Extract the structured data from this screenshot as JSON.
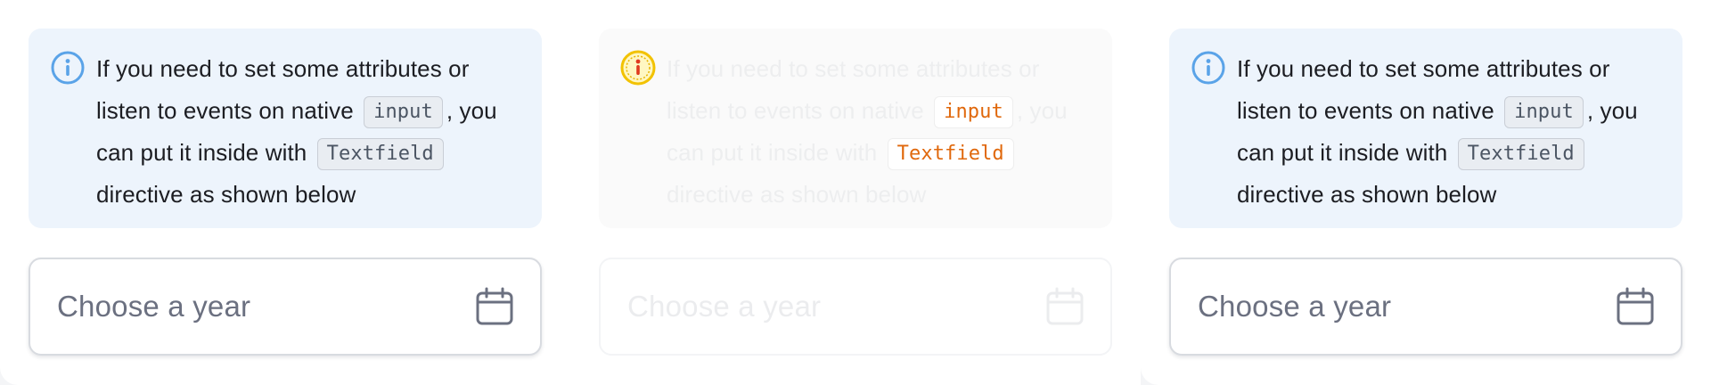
{
  "panels": [
    {
      "alert": {
        "text_1": "If you need to set some attributes or listen to events on native",
        "code_1": "input",
        "text_2": ", you can put it inside with",
        "code_2": "Textfield",
        "text_3": "directive as shown below"
      },
      "field": {
        "placeholder": "Choose a year"
      },
      "icons": {
        "alert": "info-icon",
        "field": "calendar-icon"
      }
    },
    {
      "alert": {
        "text_1": "If you need to set some attributes or listen to events on native",
        "code_1": "input",
        "text_2": ", you can put it inside with",
        "code_2": "Textfield",
        "text_3": "directive as shown below"
      },
      "field": {
        "placeholder": "Choose a year"
      },
      "icons": {
        "alert": "info-icon-highlighted",
        "field": "calendar-icon"
      }
    },
    {
      "alert": {
        "text_1": "If you need to set some attributes or listen to events on native",
        "code_1": "input",
        "text_2": ", you can put it inside with",
        "code_2": "Textfield",
        "text_3": "directive as shown below"
      },
      "field": {
        "placeholder": "Choose a year"
      },
      "icons": {
        "alert": "info-icon",
        "field": "calendar-icon"
      }
    }
  ],
  "colors": {
    "alert_background": "#edf4fc",
    "info_icon": "#5aa3e8",
    "highlight_ring": "#f2c200",
    "highlight_fill": "#e03b1f",
    "code_accent": "#e0680c"
  }
}
